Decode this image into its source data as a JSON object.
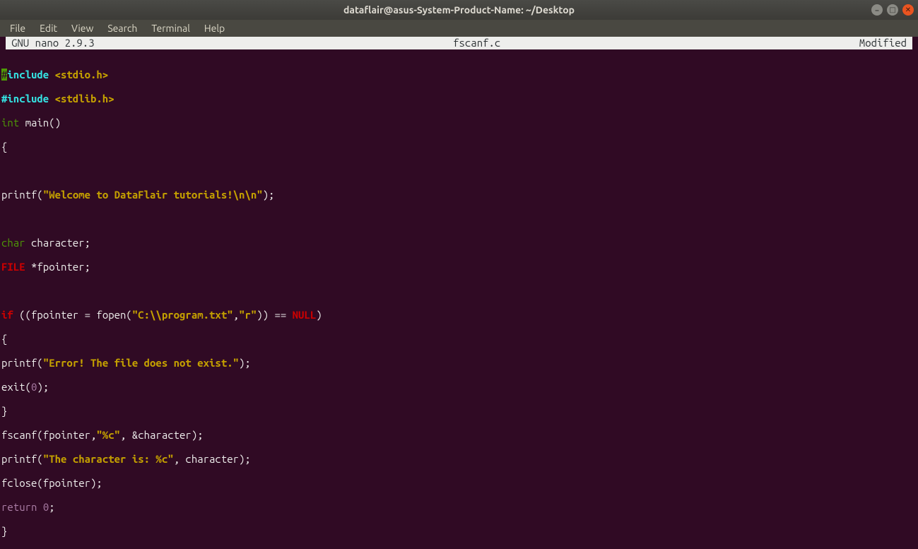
{
  "window": {
    "title": "dataflair@asus-System-Product-Name: ~/Desktop"
  },
  "menu": {
    "file": "File",
    "edit": "Edit",
    "view": "View",
    "search": "Search",
    "terminal": "Terminal",
    "help": "Help"
  },
  "status": {
    "left": "  GNU nano 2.9.3",
    "center": "fscanf.c",
    "right": "Modified"
  },
  "code": {
    "l1": {
      "a": "#",
      "b": "include ",
      "c": "<stdio.h>"
    },
    "l2": {
      "a": "#include ",
      "b": "<stdlib.h>"
    },
    "l3": {
      "a": "int",
      "b": " main()"
    },
    "l4": "{",
    "l5": "",
    "l6": {
      "a": "printf(",
      "b": "\"Welcome to DataFlair tutorials!\\n\\n\"",
      "c": ");"
    },
    "l7": "",
    "l8": {
      "a": "char",
      "b": " character;"
    },
    "l9": {
      "a": "FILE",
      "b": " *fpointer;"
    },
    "l10": "",
    "l11": {
      "a": "if",
      "b": " ((fpointer = fopen(",
      "c": "\"C:\\\\program.txt\"",
      "d": ",",
      "e": "\"r\"",
      "f": ")) == ",
      "g": "NULL",
      "h": ")"
    },
    "l12": "{",
    "l13": {
      "a": "printf(",
      "b": "\"Error! The file does not exist.\"",
      "c": ");"
    },
    "l14": {
      "a": "exit(",
      "b": "0",
      "c": ");"
    },
    "l15": "}",
    "l16": {
      "a": "fscanf(fpointer,",
      "b": "\"%c\"",
      "c": ", &character);"
    },
    "l17": {
      "a": "printf(",
      "b": "\"The character is: %c\"",
      "c": ", character);"
    },
    "l18": "fclose(fpointer);",
    "l19": {
      "a": "return ",
      "b": "0",
      "c": ";"
    },
    "l20": "}"
  },
  "icons": {
    "min": "–",
    "max": "□",
    "close": "✕"
  }
}
